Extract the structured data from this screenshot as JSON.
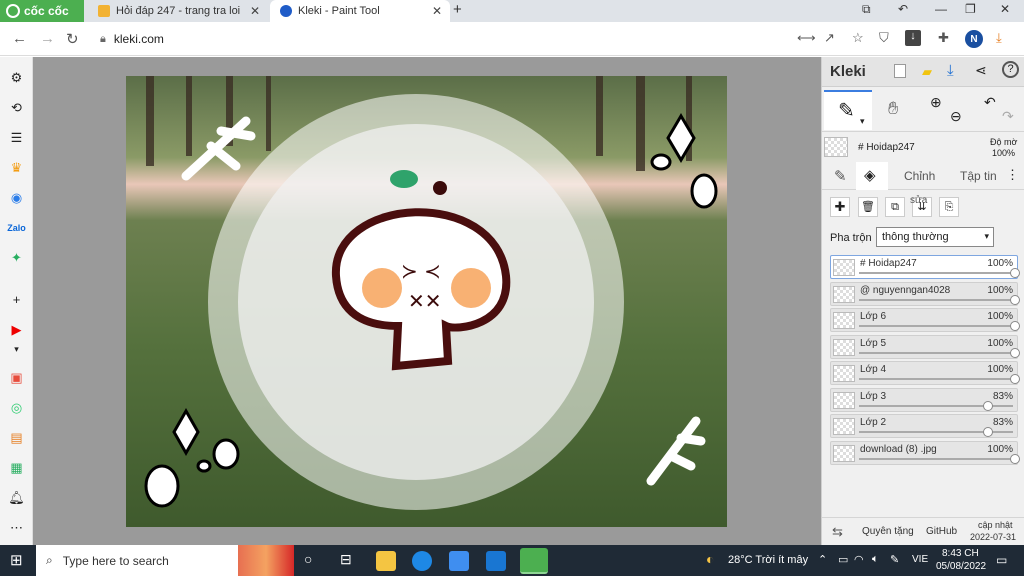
{
  "browser": {
    "brand": "cốc cốc",
    "tabs": [
      {
        "label": "Hỏi đáp 247 - trang tra loi",
        "active": false,
        "favicon_color": "#f2b233"
      },
      {
        "label": "Kleki - Paint Tool",
        "active": true,
        "favicon_color": "#1f5cc8"
      }
    ],
    "url": "kleki.com",
    "profile_initial": "N"
  },
  "kleki": {
    "logo": "Kleki",
    "active_layer_name": "# Hoidap247",
    "opacity_label": "Độ mờ",
    "opacity_value": "100%",
    "tabs": [
      "Chỉnh",
      "Tập tin"
    ],
    "edit_label": "sửa",
    "blend_label": "Pha trộn",
    "blend_value": "thông thường",
    "layers": [
      {
        "name": "# Hoidap247",
        "opacity": "100%",
        "fill": 1.0,
        "selected": true
      },
      {
        "name": "@ nguyenngan4028",
        "opacity": "100%",
        "fill": 1.0,
        "selected": false
      },
      {
        "name": "Lớp 6",
        "opacity": "100%",
        "fill": 1.0,
        "selected": false
      },
      {
        "name": "Lớp 5",
        "opacity": "100%",
        "fill": 1.0,
        "selected": false
      },
      {
        "name": "Lớp 4",
        "opacity": "100%",
        "fill": 1.0,
        "selected": false
      },
      {
        "name": "Lớp 3",
        "opacity": "83%",
        "fill": 0.83,
        "selected": false
      },
      {
        "name": "Lớp 2",
        "opacity": "83%",
        "fill": 0.83,
        "selected": false
      },
      {
        "name": "download (8) .jpg",
        "opacity": "100%",
        "fill": 1.0,
        "selected": false
      }
    ],
    "footer": {
      "privacy": "Quyên tặng",
      "github": "GitHub",
      "update_label": "cập nhật",
      "update_date": "2022-07-31"
    }
  },
  "taskbar": {
    "search_placeholder": "Type here to search",
    "weather": "28°C  Trời ít mây",
    "lang": "VIE",
    "time": "8:43 CH",
    "date": "05/08/2022"
  }
}
